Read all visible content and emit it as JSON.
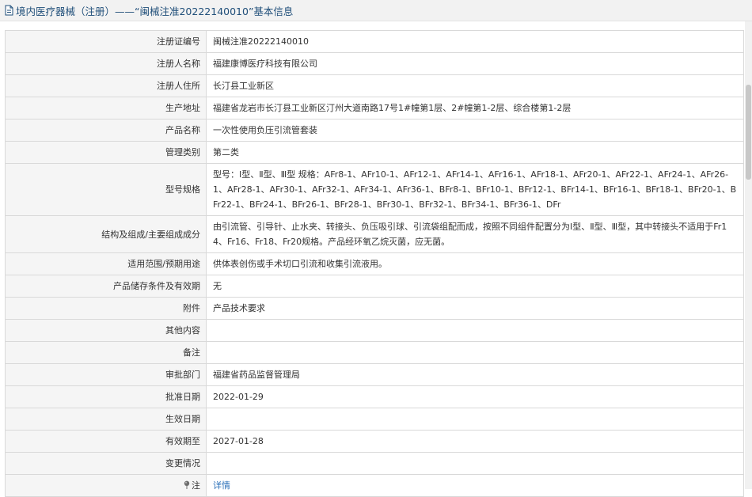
{
  "header": {
    "title": "境内医疗器械（注册）——“闽械注准20222140010”基本信息"
  },
  "rows": [
    {
      "label": "注册证编号",
      "value": "闽械注准20222140010"
    },
    {
      "label": "注册人名称",
      "value": "福建康博医疗科技有限公司"
    },
    {
      "label": "注册人住所",
      "value": "长汀县工业新区"
    },
    {
      "label": "生产地址",
      "value": "福建省龙岩市长汀县工业新区汀州大道南路17号1#幢第1层、2#幢第1-2层、综合楼第1-2层"
    },
    {
      "label": "产品名称",
      "value": "一次性使用负压引流管套装"
    },
    {
      "label": "管理类别",
      "value": "第二类"
    },
    {
      "label": "型号规格",
      "value": "型号：Ⅰ型、Ⅱ型、Ⅲ型 规格：AFr8-1、AFr10-1、AFr12-1、AFr14-1、AFr16-1、AFr18-1、AFr20-1、AFr22-1、AFr24-1、AFr26-1、AFr28-1、AFr30-1、AFr32-1、AFr34-1、AFr36-1、BFr8-1、BFr10-1、BFr12-1、BFr14-1、BFr16-1、BFr18-1、BFr20-1、BFr22-1、BFr24-1、BFr26-1、BFr28-1、BFr30-1、BFr32-1、BFr34-1、BFr36-1、DFr"
    },
    {
      "label": "结构及组成/主要组成成分",
      "value": "由引流管、引导针、止水夹、转接头、负压吸引球、引流袋组配而成，按照不同组件配置分为Ⅰ型、Ⅱ型、Ⅲ型，其中转接头不适用于Fr14、Fr16、Fr18、Fr20规格。产品经环氧乙烷灭菌，应无菌。"
    },
    {
      "label": "适用范围/预期用途",
      "value": "供体表创伤或手术切口引流和收集引流液用。"
    },
    {
      "label": "产品储存条件及有效期",
      "value": "无"
    },
    {
      "label": "附件",
      "value": "产品技术要求"
    },
    {
      "label": "其他内容",
      "value": ""
    },
    {
      "label": "备注",
      "value": ""
    },
    {
      "label": "审批部门",
      "value": "福建省药品监督管理局"
    },
    {
      "label": "批准日期",
      "value": "2022-01-29"
    },
    {
      "label": "生效日期",
      "value": ""
    },
    {
      "label": "有效期至",
      "value": "2027-01-28"
    },
    {
      "label": "变更情况",
      "value": ""
    },
    {
      "label": "注",
      "value": "详情",
      "icon": "pin-icon"
    }
  ]
}
